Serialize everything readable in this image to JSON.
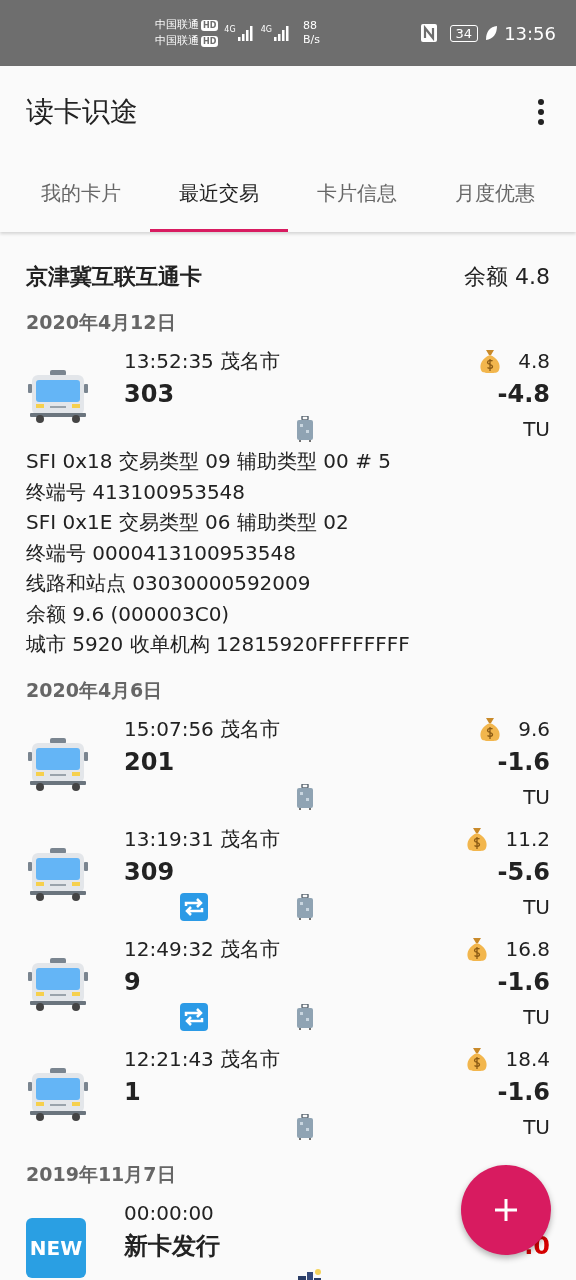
{
  "status_bar": {
    "carriers": [
      {
        "name": "中国联通",
        "badge": "HD"
      },
      {
        "name": "中国联通",
        "badge": "HD"
      }
    ],
    "network_labels": [
      "4G",
      "4G"
    ],
    "speed": "88",
    "speed_unit": "B/s",
    "battery": "34",
    "time": "13:56"
  },
  "app_bar": {
    "title": "读卡识途"
  },
  "tabs": [
    {
      "label": "我的卡片",
      "selected": false
    },
    {
      "label": "最近交易",
      "selected": true
    },
    {
      "label": "卡片信息",
      "selected": false
    },
    {
      "label": "月度优惠",
      "selected": false
    }
  ],
  "card": {
    "name": "京津冀互联互通卡",
    "balance": "余额 4.8"
  },
  "groups": [
    {
      "date": "2020年4月12日",
      "transactions": [
        {
          "kind": "bus",
          "time": "13:52:35  茂名市",
          "route": "303",
          "balance": "4.8",
          "amount": "-4.8",
          "unit": "TU",
          "transfer": false,
          "credit": false,
          "details": [
            "SFI 0x18  交易类型 09  辅助类型 00  # 5",
            "终端号 413100953548",
            "SFI 0x1E  交易类型 06  辅助类型 02",
            "终端号 0000413100953548",
            "线路和站点 03030000592009",
            "余额 9.6 (000003C0)",
            "城市 5920  收单机构 12815920FFFFFFFF"
          ]
        }
      ]
    },
    {
      "date": "2020年4月6日",
      "transactions": [
        {
          "kind": "bus",
          "time": "15:07:56  茂名市",
          "route": "201",
          "balance": "9.6",
          "amount": "-1.6",
          "unit": "TU",
          "transfer": false,
          "credit": false
        },
        {
          "kind": "bus",
          "time": "13:19:31  茂名市",
          "route": "309",
          "balance": "11.2",
          "amount": "-5.6",
          "unit": "TU",
          "transfer": true,
          "credit": false
        },
        {
          "kind": "bus",
          "time": "12:49:32  茂名市",
          "route": "9",
          "balance": "16.8",
          "amount": "-1.6",
          "unit": "TU",
          "transfer": true,
          "credit": false
        },
        {
          "kind": "bus",
          "time": "12:21:43  茂名市",
          "route": "1",
          "balance": "18.4",
          "amount": "-1.6",
          "unit": "TU",
          "transfer": false,
          "credit": false
        }
      ]
    },
    {
      "date": "2019年11月7日",
      "transactions": [
        {
          "kind": "issue",
          "badge": "NEW",
          "time": "00:00:00",
          "route": "新卡发行",
          "amount": ".0",
          "transfer": false,
          "credit": true
        }
      ]
    }
  ]
}
